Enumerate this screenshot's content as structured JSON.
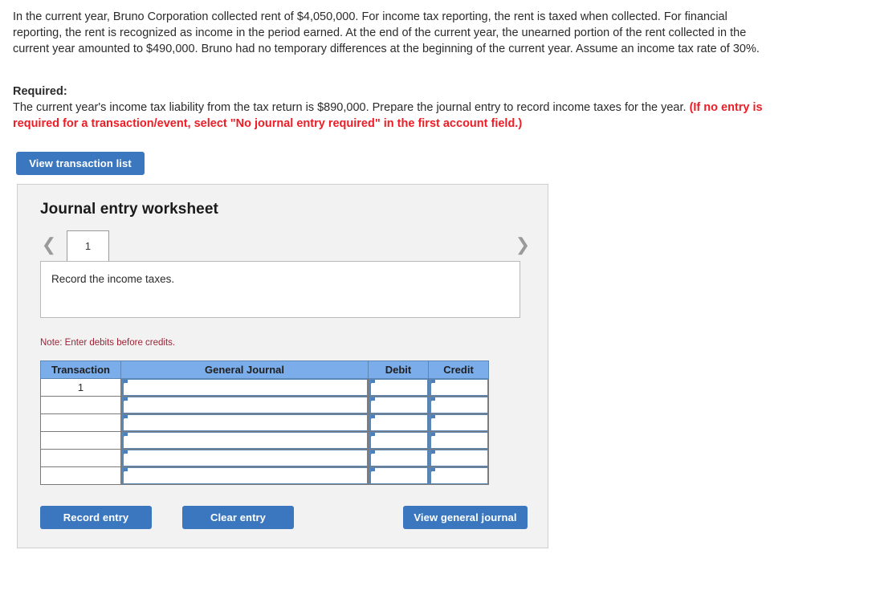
{
  "problem": {
    "text": "In the current year, Bruno Corporation collected rent of $4,050,000. For income tax reporting, the rent is taxed when collected. For financial reporting, the rent is recognized as income in the period earned. At the end of the current year, the unearned portion of the rent collected in the current year amounted to $490,000. Bruno had no temporary differences at the beginning of the current year. Assume an income tax rate of 30%."
  },
  "required": {
    "label": "Required:",
    "text": "The current year's income tax liability from the tax return is $890,000. Prepare the journal entry to record income taxes for the year. ",
    "emphasis": "(If no entry is required for a transaction/event, select \"No journal entry required\" in the first account field.)"
  },
  "toolbar": {
    "view_transaction_list_label": "View transaction list"
  },
  "worksheet": {
    "title": "Journal entry worksheet",
    "prev_icon": "chevron-left-icon",
    "next_icon": "chevron-right-icon",
    "tabs": [
      {
        "label": "1",
        "active": true
      }
    ],
    "description": "Record the income taxes.",
    "note": "Note: Enter debits before credits.",
    "table": {
      "headers": [
        "Transaction",
        "General Journal",
        "Debit",
        "Credit"
      ],
      "rows": [
        {
          "transaction": "1",
          "general_journal": "",
          "debit": "",
          "credit": ""
        },
        {
          "transaction": "",
          "general_journal": "",
          "debit": "",
          "credit": ""
        },
        {
          "transaction": "",
          "general_journal": "",
          "debit": "",
          "credit": ""
        },
        {
          "transaction": "",
          "general_journal": "",
          "debit": "",
          "credit": ""
        },
        {
          "transaction": "",
          "general_journal": "",
          "debit": "",
          "credit": ""
        },
        {
          "transaction": "",
          "general_journal": "",
          "debit": "",
          "credit": ""
        }
      ]
    },
    "buttons": {
      "record_entry": "Record entry",
      "clear_entry": "Clear entry",
      "view_general_journal": "View general journal"
    }
  },
  "colors": {
    "button_blue": "#3b77bf",
    "table_header_blue": "#7badea",
    "required_red": "#ee1c25",
    "note_maroon": "#9b2335",
    "panel_gray": "#f2f2f2"
  }
}
